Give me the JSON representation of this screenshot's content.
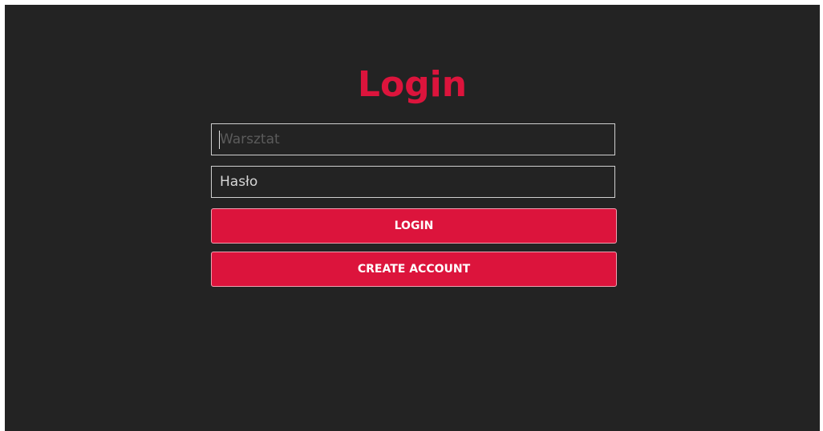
{
  "login_form": {
    "title": "Login",
    "username": {
      "placeholder": "Warsztat",
      "value": ""
    },
    "password": {
      "placeholder": "",
      "value": "Hasło"
    },
    "login_button_label": "LOGIN",
    "create_account_button_label": "CREATE ACCOUNT"
  },
  "colors": {
    "background": "#232323",
    "accent": "#dc143c",
    "field_border": "#cfcfcf",
    "placeholder_text": "#5b5b5b",
    "value_text": "#d6d6d6",
    "button_text": "#ffffff"
  }
}
